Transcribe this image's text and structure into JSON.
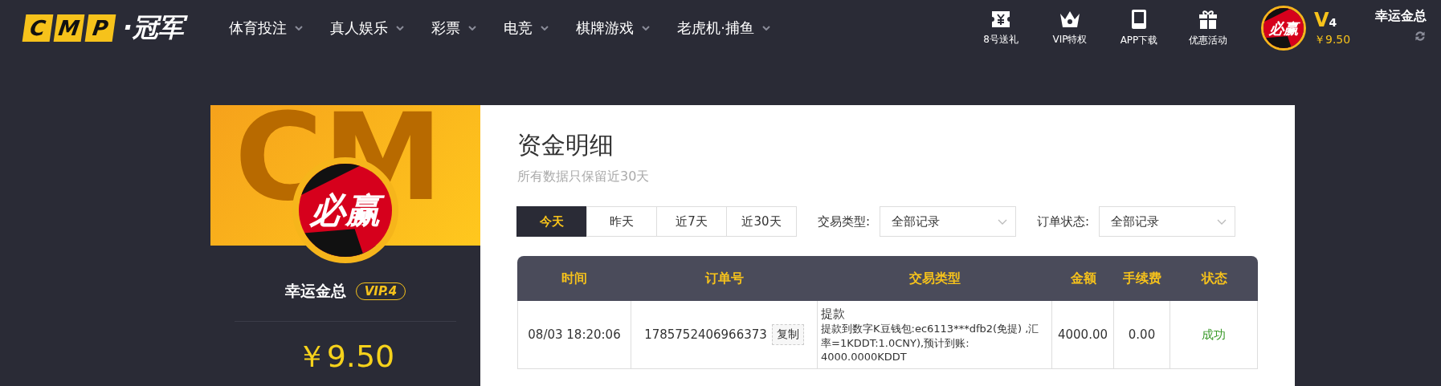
{
  "logo": {
    "letters": [
      "C",
      "M",
      "P"
    ],
    "suffix": "·冠军"
  },
  "nav": [
    {
      "label": "体育投注"
    },
    {
      "label": "真人娱乐"
    },
    {
      "label": "彩票"
    },
    {
      "label": "电竞"
    },
    {
      "label": "棋牌游戏"
    },
    {
      "label": "老虎机·捕鱼"
    }
  ],
  "quick_links": [
    {
      "kind": "ticket",
      "label": "8号送礼"
    },
    {
      "kind": "crown",
      "label": "VIP特权"
    },
    {
      "kind": "tablet",
      "label": "APP下载"
    },
    {
      "kind": "gift",
      "label": "优惠活动"
    }
  ],
  "user": {
    "avatar_text": "必赢",
    "vip_letter": "V",
    "vip_level": "4",
    "balance": "￥9.50",
    "name": "幸运金总"
  },
  "profile": {
    "banner_text": "CM",
    "avatar_text": "必赢",
    "name": "幸运金总",
    "vip": "VIP.4",
    "balance": "￥9.50"
  },
  "page": {
    "title": "资金明细",
    "subtitle": "所有数据只保留近30天"
  },
  "ranges": [
    {
      "label": "今天",
      "selected": true
    },
    {
      "label": "昨天",
      "selected": false
    },
    {
      "label": "近7天",
      "selected": false
    },
    {
      "label": "近30天",
      "selected": false
    }
  ],
  "filters": [
    {
      "label": "交易类型:",
      "value": "全部记录"
    },
    {
      "label": "订单状态:",
      "value": "全部记录"
    }
  ],
  "table": {
    "columns": [
      "时间",
      "订单号",
      "交易类型",
      "金额",
      "手续费",
      "状态"
    ],
    "rows": [
      {
        "time": "08/03 18:20:06",
        "order": "1785752406966373",
        "copy": "复制",
        "type": "提款",
        "detail": "提款到数字K豆钱包:ec6113***dfb2(免提) ,汇率=1KDDT:1.0CNY),预计到账: 4000.0000KDDT",
        "amount": "4000.00",
        "fee": "0.00",
        "status": "成功",
        "color": "#3a9a2a"
      }
    ]
  }
}
